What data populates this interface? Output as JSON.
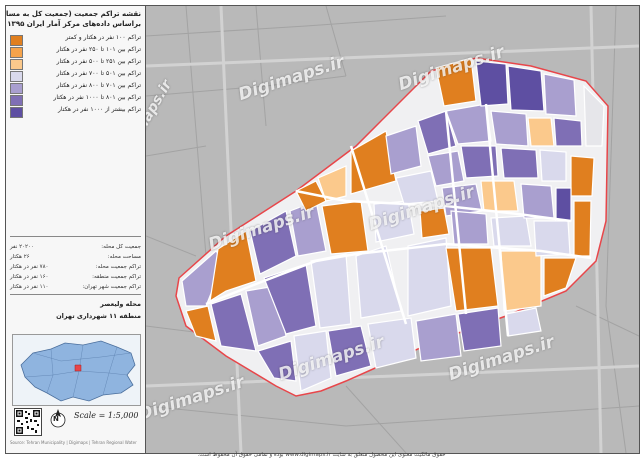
{
  "header": {
    "title_line1": "نقشه تراکم جمعیت (جمعیت کل به مساحت)",
    "title_line2": "براساس داده‌های مرکز آمار ایران ۱۳۹۵"
  },
  "legend": {
    "items": [
      {
        "label": "تراکم ۱۰۰ نفر در هکتار و کمتر",
        "color": "#e07f1f"
      },
      {
        "label": "تراکم بین ۱۰۱ تا ۲۵۰ نفر در هکتار",
        "color": "#f5a34b"
      },
      {
        "label": "تراکم بین ۲۵۱ تا ۵۰۰ نفر در هکتار",
        "color": "#fbc98c"
      },
      {
        "label": "تراکم بین ۵۰۱ تا ۷۰۰ نفر در هکتار",
        "color": "#d9d9ec"
      },
      {
        "label": "تراکم بین ۷۰۱ تا ۸۰۰ نفر در هکتار",
        "color": "#a99fcf"
      },
      {
        "label": "تراکم بین ۸۰۱ تا ۱۰۰۰ نفر در هکتار",
        "color": "#7f6fb5"
      },
      {
        "label": "تراکم بیشتر از ۱۰۰۰ نفر در هکتار",
        "color": "#5e4fa2"
      }
    ]
  },
  "stats": [
    {
      "key": "جمعیت کل محله:",
      "value": "۲۰۲۰۰ نفر"
    },
    {
      "key": "مساحت محله:",
      "value": "۲۶ هکتار"
    },
    {
      "key": "تراکم جمعیت محله:",
      "value": "۷۸۰ نفر در هکتار"
    },
    {
      "key": "تراکم جمعیت منطقه:",
      "value": "۱۶۰ نفر در هکتار"
    },
    {
      "key": "تراکم جمعیت شهر تهران:",
      "value": "۱۱۰ نفر در هکتار"
    }
  ],
  "location": {
    "neighborhood": "محله ولیعصر",
    "district": "منطقه ۱۱ شهرداری تهران"
  },
  "scale_text": "Scale = 1:5,000",
  "north_label": "N",
  "credit_side": "Source: Tehran Municipality | Digimaps | Tehran Regional Water",
  "footer": "حقوق مالکیت معنوی این محصول متعلق به سایت www.digimaps.ir بوده و تمامی حقوق آن محفوظ است.",
  "watermark": "Digimaps.ir",
  "colors": {
    "map_background": "#b9b9b9",
    "boundary": "#e8464a",
    "road": "#ffffff"
  }
}
